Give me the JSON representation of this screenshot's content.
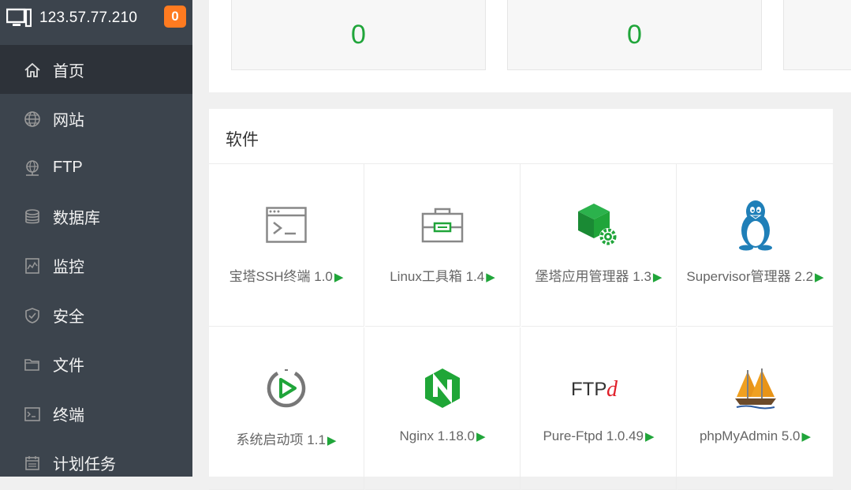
{
  "header": {
    "ip": "123.57.77.210",
    "badge": "0"
  },
  "sidebar": {
    "items": [
      {
        "label": "首页",
        "icon": "home-icon",
        "active": true
      },
      {
        "label": "网站",
        "icon": "globe-icon"
      },
      {
        "label": "FTP",
        "icon": "ftp-icon"
      },
      {
        "label": "数据库",
        "icon": "database-icon"
      },
      {
        "label": "监控",
        "icon": "monitor-icon"
      },
      {
        "label": "安全",
        "icon": "shield-icon"
      },
      {
        "label": "文件",
        "icon": "folder-icon"
      },
      {
        "label": "终端",
        "icon": "terminal-icon"
      },
      {
        "label": "计划任务",
        "icon": "calendar-icon"
      }
    ]
  },
  "stats": {
    "values": [
      "0",
      "0"
    ]
  },
  "software": {
    "title": "软件",
    "play_glyph": "▶",
    "items": [
      {
        "name": "宝塔SSH终端 1.0",
        "icon": "ssh-terminal-icon"
      },
      {
        "name": "Linux工具箱 1.4",
        "icon": "toolbox-icon"
      },
      {
        "name": "堡塔应用管理器 1.3",
        "icon": "app-manager-icon"
      },
      {
        "name": "Supervisor管理器 2.2",
        "icon": "tux-penguin-icon"
      },
      {
        "name": "系统启动项 1.1",
        "icon": "startup-icon"
      },
      {
        "name": "Nginx 1.18.0",
        "icon": "nginx-icon"
      },
      {
        "name": "Pure-Ftpd 1.0.49",
        "icon": "pure-ftpd-icon",
        "logo_text": "FTPd"
      },
      {
        "name": "phpMyAdmin 5.0",
        "icon": "phpmyadmin-icon"
      }
    ]
  },
  "colors": {
    "sidebar_bg": "#3c444d",
    "active_bg": "#2d3239",
    "accent_green": "#20a53a",
    "badge_orange": "#ff7b20"
  }
}
